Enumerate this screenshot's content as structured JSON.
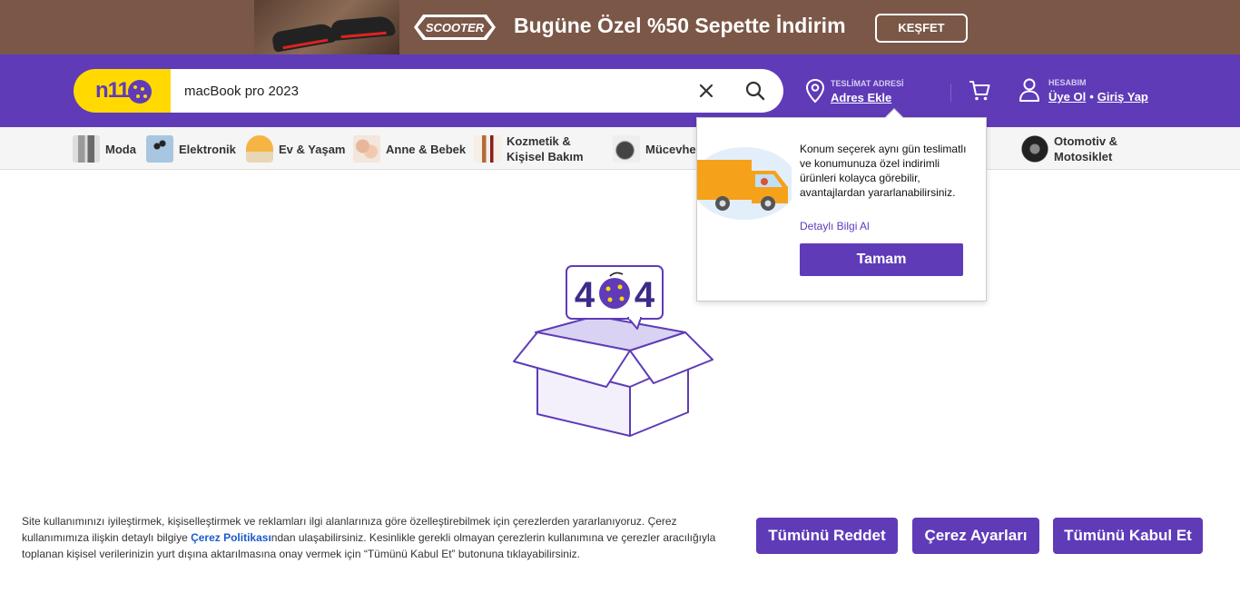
{
  "promo": {
    "brand": "SCOOTER",
    "text": "Bugüne Özel %50 Sepette İndirim",
    "button": "KEŞFET"
  },
  "header": {
    "logo": "n11",
    "search_value": "macBook pro 2023",
    "delivery_label": "TESLİMAT ADRESİ",
    "delivery_link": "Adres Ekle",
    "account_label": "HESABIM",
    "signup": "Üye Ol",
    "separator": "•",
    "login": "Giriş Yap"
  },
  "categories": [
    {
      "label": "Moda"
    },
    {
      "label": "Elektronik"
    },
    {
      "label": "Ev & Yaşam"
    },
    {
      "label": "Anne & Bebek"
    },
    {
      "label": "Kozmetik &",
      "label2": "Kişisel Bakım"
    },
    {
      "label": "Mücevhe"
    },
    {
      "label": "Otomotiv &",
      "label2": "Motosiklet"
    }
  ],
  "error": {
    "code_left": "4",
    "code_right": "4"
  },
  "popup": {
    "text": "Konum seçerek aynı gün teslimatlı ve konumunuza özel indirimli ürünleri kolayca görebilir, avantajlardan yararlanabilirsiniz.",
    "link": "Detaylı Bilgi Al",
    "button": "Tamam"
  },
  "cookie": {
    "text_before": "Site kullanımınızı iyileştirmek, kişiselleştirmek ve reklamları ilgi alanlarınıza göre özelleştirebilmek için çerezlerden yararlanıyoruz. Çerez kullanımımıza ilişkin detaylı bilgiye ",
    "policy_link": "Çerez Politikası",
    "text_after": "ndan ulaşabilirsiniz. Kesinlikle gerekli olmayan çerezlerin kullanımına ve çerezler aracılığıyla toplanan kişisel verilerinizin yurt dışına aktarılmasına onay vermek için “Tümünü Kabul Et” butonuna tıklayabilirsiniz.",
    "reject": "Tümünü Reddet",
    "settings": "Çerez Ayarları",
    "accept": "Tümünü Kabul Et"
  },
  "colors": {
    "brand_purple": "#5f3bb8",
    "brand_yellow": "#ffd900",
    "promo_bg": "#7b5747"
  }
}
